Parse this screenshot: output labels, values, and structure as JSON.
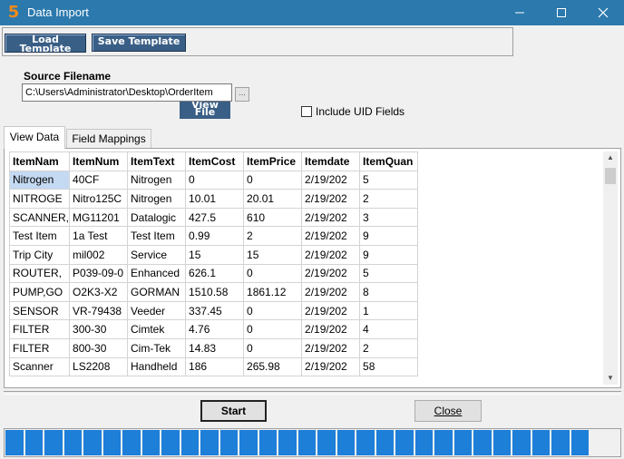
{
  "window": {
    "title": "Data Import",
    "app_icon": "5",
    "controls": [
      "minimize-icon",
      "maximize-icon",
      "close-icon"
    ]
  },
  "toolbar": {
    "load_template_label": "Load Template",
    "save_template_label": "Save Template"
  },
  "source": {
    "label": "Source Filename",
    "value": "C:\\Users\\Administrator\\Desktop\\OrderItem",
    "browse_label": "...",
    "view_file_label": "View File"
  },
  "options": {
    "include_uid_label": "Include UID Fields",
    "include_uid_checked": false
  },
  "tabs": [
    {
      "label": "View Data",
      "active": true
    },
    {
      "label": "Field Mappings",
      "active": false
    }
  ],
  "grid": {
    "columns": [
      "ItemNam",
      "ItemNum",
      "ItemText",
      "ItemCost",
      "ItemPrice",
      "Itemdate",
      "ItemQuan"
    ],
    "rows": [
      [
        "Nitrogen",
        "40CF",
        "Nitrogen",
        "0",
        "0",
        "2/19/202",
        "5"
      ],
      [
        "NITROGE",
        "Nitro125C",
        "Nitrogen",
        "10.01",
        "20.01",
        "2/19/202",
        "2"
      ],
      [
        "SCANNER,",
        "MG11201",
        "Datalogic",
        "427.5",
        "610",
        "2/19/202",
        "3"
      ],
      [
        "Test Item",
        "1a Test",
        "Test Item",
        "0.99",
        "2",
        "2/19/202",
        "9"
      ],
      [
        "Trip City",
        "mil002",
        "Service",
        "15",
        "15",
        "2/19/202",
        "9"
      ],
      [
        "ROUTER,",
        "P039-09-0",
        "Enhanced",
        "626.1",
        "0",
        "2/19/202",
        "5"
      ],
      [
        "PUMP,GO",
        "O2K3-X2",
        "GORMAN",
        "1510.58",
        "1861.12",
        "2/19/202",
        "8"
      ],
      [
        "SENSOR",
        "VR-79438",
        "Veeder",
        "337.45",
        "0",
        "2/19/202",
        "1"
      ],
      [
        "FILTER",
        "300-30",
        "Cimtek",
        "4.76",
        "0",
        "2/19/202",
        "4"
      ],
      [
        "FILTER",
        "800-30",
        "Cim-Tek",
        "14.83",
        "0",
        "2/19/202",
        "2"
      ],
      [
        "Scanner",
        "LS2208",
        "Handheld",
        "186",
        "265.98",
        "2/19/202",
        "58"
      ]
    ]
  },
  "buttons": {
    "start_label": "Start",
    "close_label": "Close"
  },
  "progress": {
    "fraction": 0.96,
    "segment_color": "#1e7fd9"
  },
  "colors": {
    "titlebar": "#2b79ad",
    "template_button": "#3a5f86",
    "selected_cell": "#c4d9f2"
  }
}
